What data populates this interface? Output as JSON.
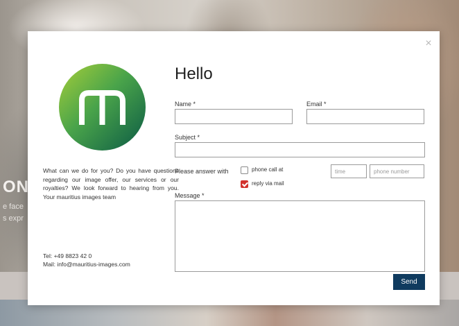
{
  "background": {
    "heading_fragment": "ON",
    "line1_fragment": "e face",
    "line2_fragment": "s expr"
  },
  "modal": {
    "close_symbol": "×",
    "title": "Hello",
    "intro_text": "What can we do for you? Do you have questions regarding our image offer, our services or our royalties? We look forward to hearing from you. Your mauritius images team",
    "tel": "Tel: +49 8823 42 0",
    "mail": "Mail: info@mauritius-images.com",
    "logo_letter": "m",
    "colors": {
      "logo_light": "#8cc63f",
      "logo_dark": "#0b6a4c",
      "send_bg": "#0f3b5f",
      "check_red": "#d2322d"
    },
    "form": {
      "name_label": "Name *",
      "email_label": "Email *",
      "subject_label": "Subject *",
      "answer_label": "Please answer with",
      "option_phone": "phone call at",
      "option_mail": "reply via mail",
      "option_phone_checked": false,
      "option_mail_checked": true,
      "time_placeholder": "time",
      "phone_placeholder": "phone number",
      "message_label": "Message *",
      "send_label": "Send"
    }
  }
}
